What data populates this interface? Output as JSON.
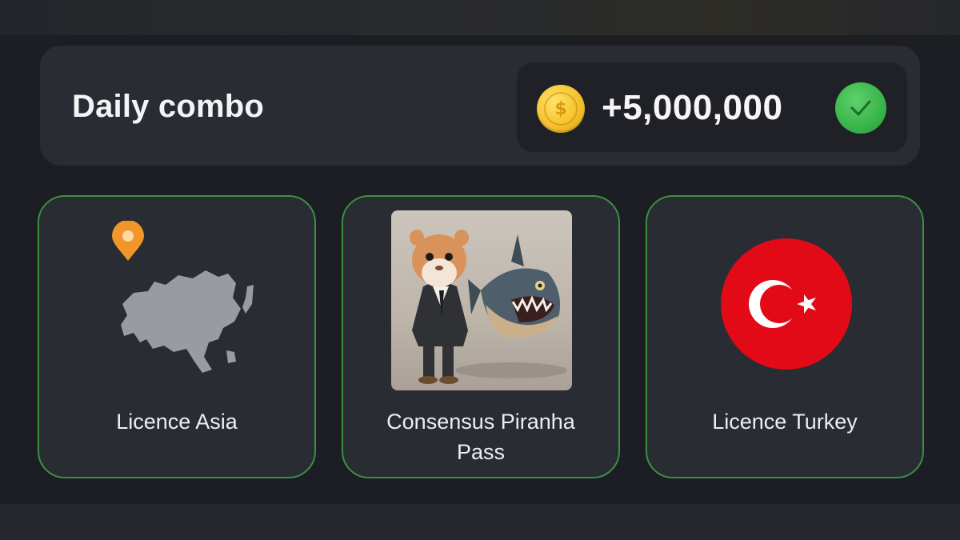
{
  "header": {
    "title": "Daily combo",
    "reward": "+5,000,000",
    "coin_symbol": "$",
    "coin_icon": "coin-icon",
    "claimed_icon": "checkmark-icon"
  },
  "cards": [
    {
      "label": "Licence Asia",
      "image": "asia-map-icon",
      "badge": "location-pin-icon"
    },
    {
      "label_line1": "Consensus Piranha",
      "label_line2": "Pass",
      "image": "hamster-and-piranha-image"
    },
    {
      "label": "Licence Turkey",
      "image": "turkey-flag-icon"
    }
  ],
  "colors": {
    "background": "#1c1e24",
    "card": "#2a2c33",
    "card_border": "#3c8f45",
    "coin": "#f5c22e",
    "check": "#39b54a",
    "pin": "#f0962a",
    "flag_red": "#e30a17"
  }
}
